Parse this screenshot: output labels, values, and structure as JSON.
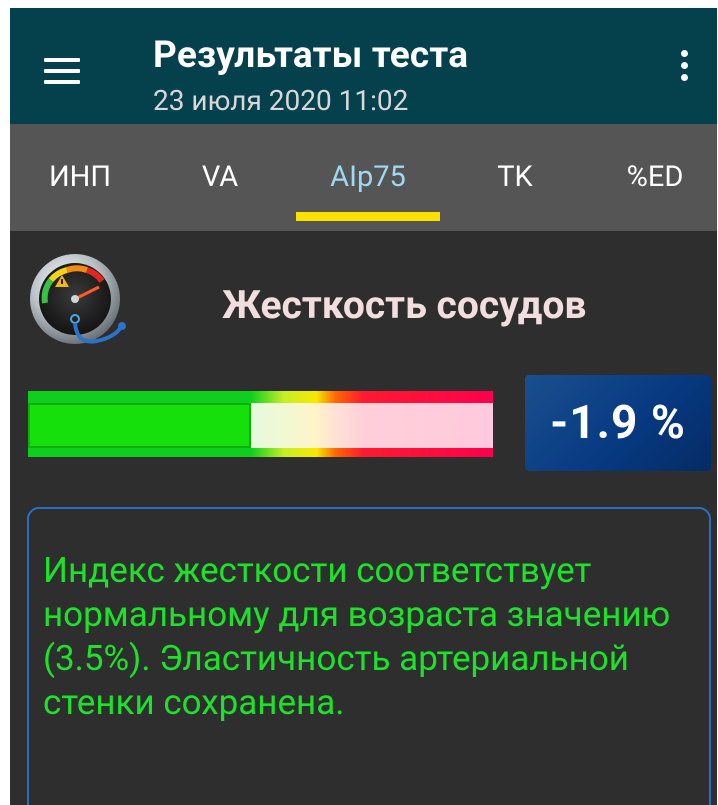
{
  "header": {
    "menu_icon": "menu-icon",
    "title": "Результаты теста",
    "subtitle": "23 июля 2020  11:02",
    "more_icon": "more-vertical-icon"
  },
  "tabs": [
    {
      "label": "ИНП",
      "active": false
    },
    {
      "label": "VA",
      "active": false
    },
    {
      "label": "AIp75",
      "active": true
    },
    {
      "label": "TK",
      "active": false
    },
    {
      "label": "%ED",
      "active": false
    }
  ],
  "section": {
    "icon": "gauge-stethoscope-icon",
    "title": "Жесткость сосудов"
  },
  "indicator": {
    "value_text": "-1.9 %",
    "fill_fraction": 0.48
  },
  "result_text": "Индекс жесткости соответствует нормальному для возраста значению (3.5%). Эластичность артериальной стенки сохранена.",
  "colors": {
    "appbar": "#05404d",
    "tabs_bg": "#555555",
    "active_tab": "#9fd8f2",
    "tab_indicator": "#ffe000",
    "content_bg": "#2e2e2e",
    "result_text": "#1ce22a",
    "card_border": "#2b6ec2",
    "badge_bg": "#073a82"
  }
}
